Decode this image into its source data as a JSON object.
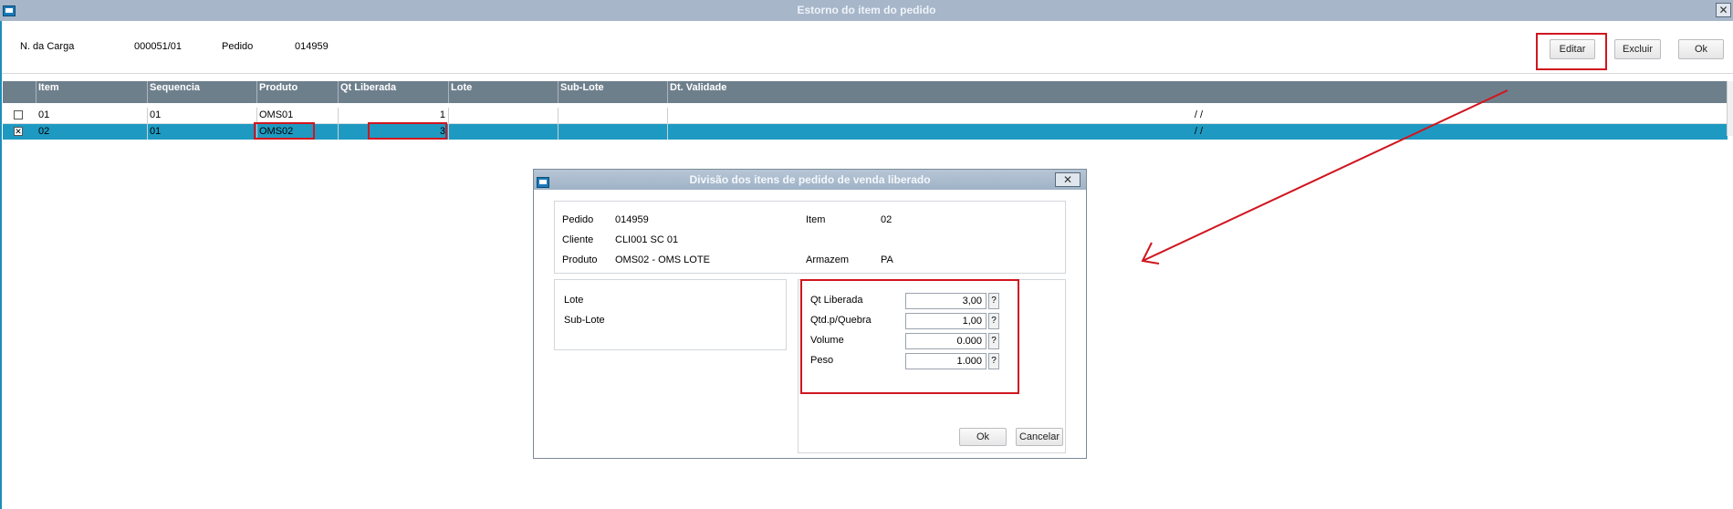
{
  "window": {
    "title": "Estorno do item do pedido",
    "close_glyph": "✕"
  },
  "header": {
    "carga_label": "N. da Carga",
    "carga_value": "000051/01",
    "pedido_label": "Pedido",
    "pedido_value": "014959"
  },
  "toolbar": {
    "editar": "Editar",
    "excluir": "Excluir",
    "ok": "Ok"
  },
  "grid": {
    "columns": [
      "Item",
      "Sequencia",
      "Produto",
      "Qt Liberada",
      "Lote",
      "Sub-Lote",
      "Dt. Validade"
    ],
    "rows": [
      {
        "checked": false,
        "check_glyph": "",
        "item": "01",
        "sequencia": "01",
        "produto": "OMS01",
        "qt_liberada": "1",
        "lote": "",
        "sub_lote": "",
        "dt_validade": "/  /"
      },
      {
        "checked": true,
        "check_glyph": "✕",
        "item": "02",
        "sequencia": "01",
        "produto": "OMS02",
        "qt_liberada": "3",
        "lote": "",
        "sub_lote": "",
        "dt_validade": "/  /"
      }
    ]
  },
  "dialog": {
    "title": "Divisão dos itens de pedido de venda liberado",
    "close_glyph": "✕",
    "pedido_label": "Pedido",
    "pedido_value": "014959",
    "item_label": "Item",
    "item_value": "02",
    "cliente_label": "Cliente",
    "cliente_value": "CLI001 SC 01",
    "produto_label": "Produto",
    "produto_value": "OMS02 - OMS LOTE",
    "armazem_label": "Armazem",
    "armazem_value": "PA",
    "lote_label": "Lote",
    "sublote_label": "Sub-Lote",
    "fields": [
      {
        "label": "Qt Liberada",
        "value": "3,00"
      },
      {
        "label": "Qtd.p/Quebra",
        "value": "1,00"
      },
      {
        "label": "Volume",
        "value": "0.000"
      },
      {
        "label": "Peso",
        "value": "1.000"
      }
    ],
    "lookup_glyph": "?",
    "ok": "Ok",
    "cancelar": "Cancelar"
  },
  "colors": {
    "accent_selected_row": "#1e9ac2",
    "highlight_red": "#d0161f",
    "grid_header": "#6e7f8c"
  },
  "icons": [
    "window-icon",
    "close-icon",
    "checkbox-icon",
    "lookup-icon",
    "annotation-arrow"
  ]
}
